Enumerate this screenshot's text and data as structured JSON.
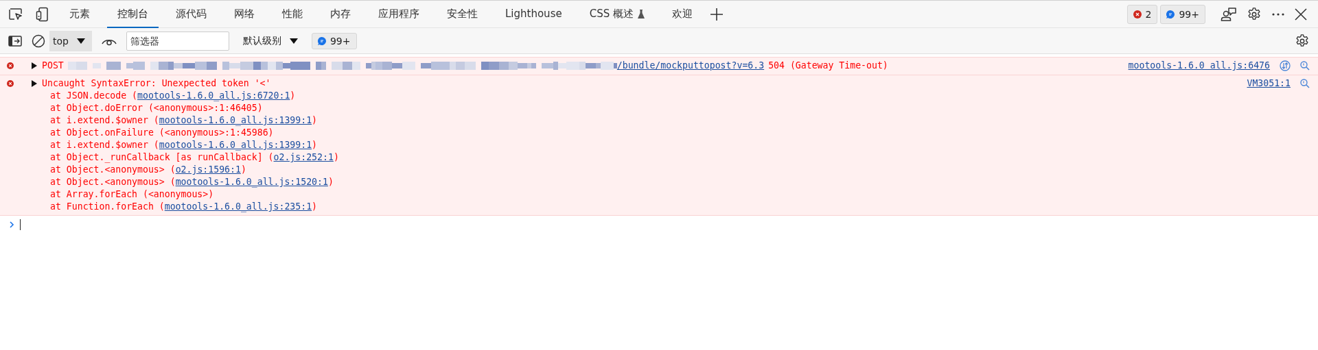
{
  "tabs": [
    {
      "label": "元素",
      "selected": false
    },
    {
      "label": "控制台",
      "selected": true
    },
    {
      "label": "源代码",
      "selected": false
    },
    {
      "label": "网络",
      "selected": false
    },
    {
      "label": "性能",
      "selected": false
    },
    {
      "label": "内存",
      "selected": false
    },
    {
      "label": "应用程序",
      "selected": false
    },
    {
      "label": "安全性",
      "selected": false
    },
    {
      "label": "Lighthouse",
      "selected": false
    },
    {
      "label": "CSS 概述",
      "selected": false,
      "experimental": true
    },
    {
      "label": "欢迎",
      "selected": false
    }
  ],
  "status_badges": {
    "errors": "2",
    "messages": "99+"
  },
  "toolbar": {
    "context": "top",
    "filter_placeholder": "筛选器",
    "level": "默认级别",
    "messages": "99+"
  },
  "messages": [
    {
      "kind": "network",
      "method": "POST",
      "url": "/bundle/mockputtopost?v=6.3",
      "status": "504 (Gateway Time-out)",
      "source": "mootools-1.6.0 all.js:6476"
    },
    {
      "kind": "exception",
      "text": "Uncaught SyntaxError: Unexpected token '<'",
      "source": "VM3051:1",
      "stack": [
        {
          "before": "at JSON.decode (",
          "link": "mootools-1.6.0_all.js:6720:1",
          "after": ")"
        },
        {
          "before": "at Object.doError (<anonymous>:1:46405)"
        },
        {
          "before": "at i.extend.$owner (",
          "link": "mootools-1.6.0_all.js:1399:1",
          "after": ")"
        },
        {
          "before": "at Object.onFailure (<anonymous>:1:45986)"
        },
        {
          "before": "at i.extend.$owner (",
          "link": "mootools-1.6.0_all.js:1399:1",
          "after": ")"
        },
        {
          "before": "at Object._runCallback [as runCallback] (",
          "link": "o2.js:252:1",
          "after": ")"
        },
        {
          "before": "at Object.<anonymous> (",
          "link": "o2.js:1596:1",
          "after": ")"
        },
        {
          "before": "at Object.<anonymous> (",
          "link": "mootools-1.6.0_all.js:1520:1",
          "after": ")"
        },
        {
          "before": "at Array.forEach (<anonymous>)"
        },
        {
          "before": "at Function.forEach (",
          "link": "mootools-1.6.0_all.js:235:1",
          "after": ")"
        }
      ]
    }
  ]
}
